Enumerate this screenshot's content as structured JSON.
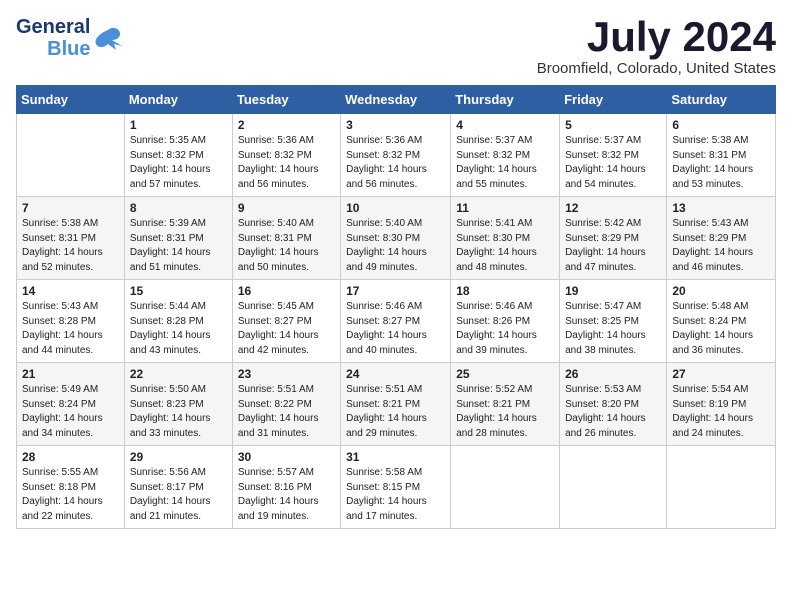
{
  "logo": {
    "line1": "General",
    "line2": "Blue"
  },
  "title": "July 2024",
  "location": "Broomfield, Colorado, United States",
  "days_header": [
    "Sunday",
    "Monday",
    "Tuesday",
    "Wednesday",
    "Thursday",
    "Friday",
    "Saturday"
  ],
  "weeks": [
    [
      {
        "day": "",
        "info": ""
      },
      {
        "day": "1",
        "info": "Sunrise: 5:35 AM\nSunset: 8:32 PM\nDaylight: 14 hours\nand 57 minutes."
      },
      {
        "day": "2",
        "info": "Sunrise: 5:36 AM\nSunset: 8:32 PM\nDaylight: 14 hours\nand 56 minutes."
      },
      {
        "day": "3",
        "info": "Sunrise: 5:36 AM\nSunset: 8:32 PM\nDaylight: 14 hours\nand 56 minutes."
      },
      {
        "day": "4",
        "info": "Sunrise: 5:37 AM\nSunset: 8:32 PM\nDaylight: 14 hours\nand 55 minutes."
      },
      {
        "day": "5",
        "info": "Sunrise: 5:37 AM\nSunset: 8:32 PM\nDaylight: 14 hours\nand 54 minutes."
      },
      {
        "day": "6",
        "info": "Sunrise: 5:38 AM\nSunset: 8:31 PM\nDaylight: 14 hours\nand 53 minutes."
      }
    ],
    [
      {
        "day": "7",
        "info": "Sunrise: 5:38 AM\nSunset: 8:31 PM\nDaylight: 14 hours\nand 52 minutes."
      },
      {
        "day": "8",
        "info": "Sunrise: 5:39 AM\nSunset: 8:31 PM\nDaylight: 14 hours\nand 51 minutes."
      },
      {
        "day": "9",
        "info": "Sunrise: 5:40 AM\nSunset: 8:31 PM\nDaylight: 14 hours\nand 50 minutes."
      },
      {
        "day": "10",
        "info": "Sunrise: 5:40 AM\nSunset: 8:30 PM\nDaylight: 14 hours\nand 49 minutes."
      },
      {
        "day": "11",
        "info": "Sunrise: 5:41 AM\nSunset: 8:30 PM\nDaylight: 14 hours\nand 48 minutes."
      },
      {
        "day": "12",
        "info": "Sunrise: 5:42 AM\nSunset: 8:29 PM\nDaylight: 14 hours\nand 47 minutes."
      },
      {
        "day": "13",
        "info": "Sunrise: 5:43 AM\nSunset: 8:29 PM\nDaylight: 14 hours\nand 46 minutes."
      }
    ],
    [
      {
        "day": "14",
        "info": "Sunrise: 5:43 AM\nSunset: 8:28 PM\nDaylight: 14 hours\nand 44 minutes."
      },
      {
        "day": "15",
        "info": "Sunrise: 5:44 AM\nSunset: 8:28 PM\nDaylight: 14 hours\nand 43 minutes."
      },
      {
        "day": "16",
        "info": "Sunrise: 5:45 AM\nSunset: 8:27 PM\nDaylight: 14 hours\nand 42 minutes."
      },
      {
        "day": "17",
        "info": "Sunrise: 5:46 AM\nSunset: 8:27 PM\nDaylight: 14 hours\nand 40 minutes."
      },
      {
        "day": "18",
        "info": "Sunrise: 5:46 AM\nSunset: 8:26 PM\nDaylight: 14 hours\nand 39 minutes."
      },
      {
        "day": "19",
        "info": "Sunrise: 5:47 AM\nSunset: 8:25 PM\nDaylight: 14 hours\nand 38 minutes."
      },
      {
        "day": "20",
        "info": "Sunrise: 5:48 AM\nSunset: 8:24 PM\nDaylight: 14 hours\nand 36 minutes."
      }
    ],
    [
      {
        "day": "21",
        "info": "Sunrise: 5:49 AM\nSunset: 8:24 PM\nDaylight: 14 hours\nand 34 minutes."
      },
      {
        "day": "22",
        "info": "Sunrise: 5:50 AM\nSunset: 8:23 PM\nDaylight: 14 hours\nand 33 minutes."
      },
      {
        "day": "23",
        "info": "Sunrise: 5:51 AM\nSunset: 8:22 PM\nDaylight: 14 hours\nand 31 minutes."
      },
      {
        "day": "24",
        "info": "Sunrise: 5:51 AM\nSunset: 8:21 PM\nDaylight: 14 hours\nand 29 minutes."
      },
      {
        "day": "25",
        "info": "Sunrise: 5:52 AM\nSunset: 8:21 PM\nDaylight: 14 hours\nand 28 minutes."
      },
      {
        "day": "26",
        "info": "Sunrise: 5:53 AM\nSunset: 8:20 PM\nDaylight: 14 hours\nand 26 minutes."
      },
      {
        "day": "27",
        "info": "Sunrise: 5:54 AM\nSunset: 8:19 PM\nDaylight: 14 hours\nand 24 minutes."
      }
    ],
    [
      {
        "day": "28",
        "info": "Sunrise: 5:55 AM\nSunset: 8:18 PM\nDaylight: 14 hours\nand 22 minutes."
      },
      {
        "day": "29",
        "info": "Sunrise: 5:56 AM\nSunset: 8:17 PM\nDaylight: 14 hours\nand 21 minutes."
      },
      {
        "day": "30",
        "info": "Sunrise: 5:57 AM\nSunset: 8:16 PM\nDaylight: 14 hours\nand 19 minutes."
      },
      {
        "day": "31",
        "info": "Sunrise: 5:58 AM\nSunset: 8:15 PM\nDaylight: 14 hours\nand 17 minutes."
      },
      {
        "day": "",
        "info": ""
      },
      {
        "day": "",
        "info": ""
      },
      {
        "day": "",
        "info": ""
      }
    ]
  ]
}
